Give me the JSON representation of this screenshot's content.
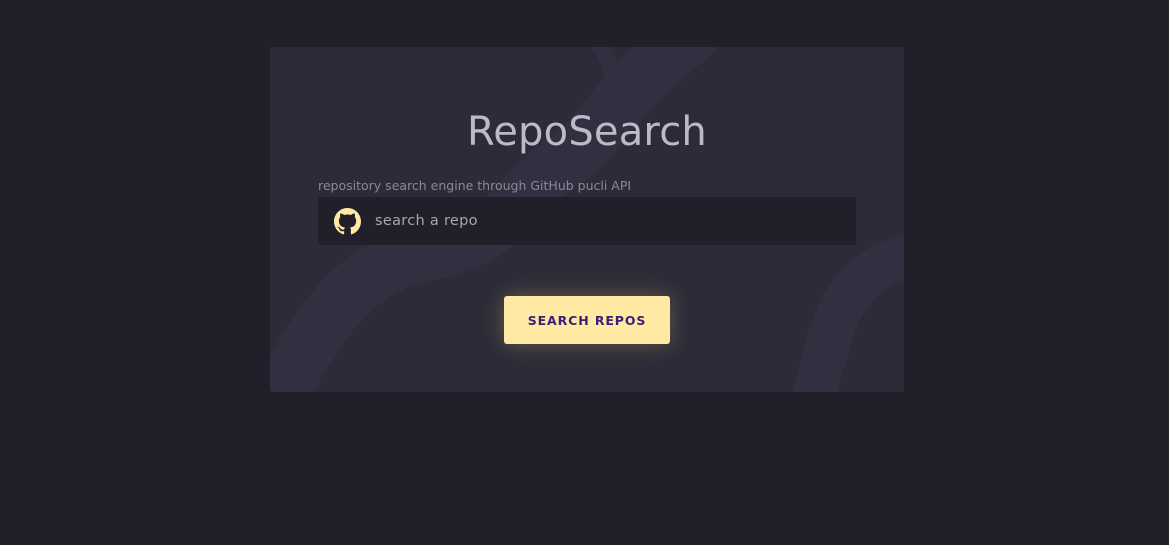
{
  "app": {
    "title": "RepoSearch",
    "subtitle": "repository search engine through GitHub pucli API"
  },
  "search": {
    "placeholder": "search a repo",
    "value": "",
    "icon": "github-icon"
  },
  "actions": {
    "search_label": "SEARCH REPOS"
  },
  "colors": {
    "page_background": "#21202a",
    "card_background": "#2c2b38",
    "accent": "#ffe9a3",
    "button_text": "#3b1f73",
    "title_text": "#bcbac6"
  }
}
